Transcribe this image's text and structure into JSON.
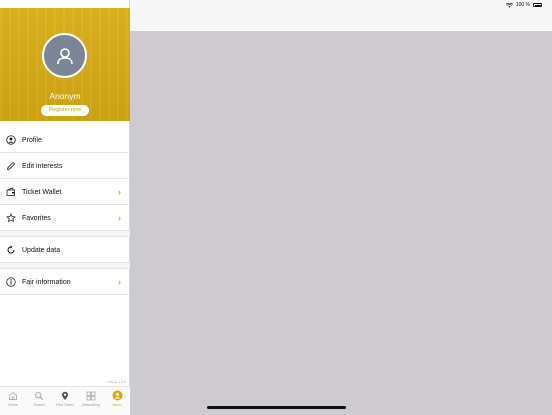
{
  "status_bar": {
    "battery_text": "100 %"
  },
  "side_menu": {
    "username": "Anonym",
    "register_label": "Register now",
    "items": [
      {
        "label": "Profile",
        "icon": "user-circle-icon",
        "has_chevron": false
      },
      {
        "label": "Edit interests",
        "icon": "pencil-icon",
        "has_chevron": false
      },
      {
        "label": "Ticket Wallet",
        "icon": "wallet-icon",
        "has_chevron": true
      },
      {
        "label": "Favorites",
        "icon": "star-icon",
        "has_chevron": true
      },
      {
        "label": "Update data",
        "icon": "refresh-icon",
        "has_chevron": false
      },
      {
        "label": "Fair information",
        "icon": "info-icon",
        "has_chevron": true
      }
    ],
    "chevron": "›",
    "version": "v.2022.1.0.0"
  },
  "tab_bar": {
    "tabs": [
      {
        "label": "Home",
        "icon": "home-icon"
      },
      {
        "label": "Search",
        "icon": "search-icon"
      },
      {
        "label": "Find Stand",
        "icon": "map-pin-icon"
      },
      {
        "label": "Networking",
        "icon": "networking-icon"
      },
      {
        "label": "Menu",
        "icon": "menu-user-icon",
        "active": true
      }
    ]
  },
  "colors": {
    "accent": "#E0A400",
    "header_bg": "#D8AB12",
    "avatar_bg": "#7A8696",
    "content_bg": "#CDCBD0"
  }
}
